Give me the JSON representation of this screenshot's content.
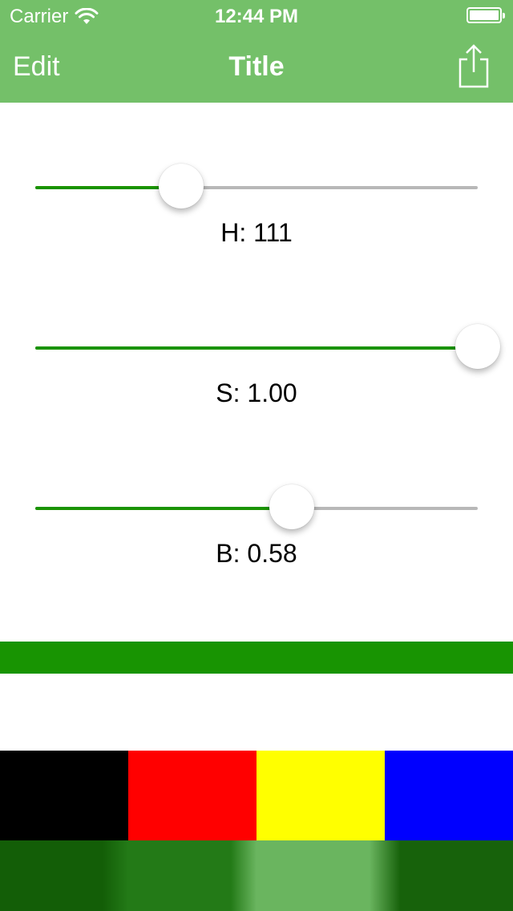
{
  "status_bar": {
    "carrier": "Carrier",
    "time": "12:44 PM",
    "wifi_icon": "wifi-icon",
    "battery_icon": "battery-icon"
  },
  "nav_bar": {
    "edit_label": "Edit",
    "title": "Title",
    "share_icon": "share-icon",
    "background_color": "#74c069"
  },
  "sliders": [
    {
      "name": "hue",
      "label": "H: 111",
      "value_fraction": 0.33
    },
    {
      "name": "saturation",
      "label": "S: 1.00",
      "value_fraction": 1.0
    },
    {
      "name": "brightness",
      "label": "B: 0.58",
      "value_fraction": 0.58
    }
  ],
  "slider_colors": {
    "min_track": "#1a9302",
    "max_track": "#b8b8b8"
  },
  "preview_color": "#189402",
  "swatches": [
    {
      "name": "black",
      "color": "#000000"
    },
    {
      "name": "red",
      "color": "#ff0000"
    },
    {
      "name": "yellow",
      "color": "#ffff00"
    },
    {
      "name": "blue",
      "color": "#0000ff"
    }
  ]
}
